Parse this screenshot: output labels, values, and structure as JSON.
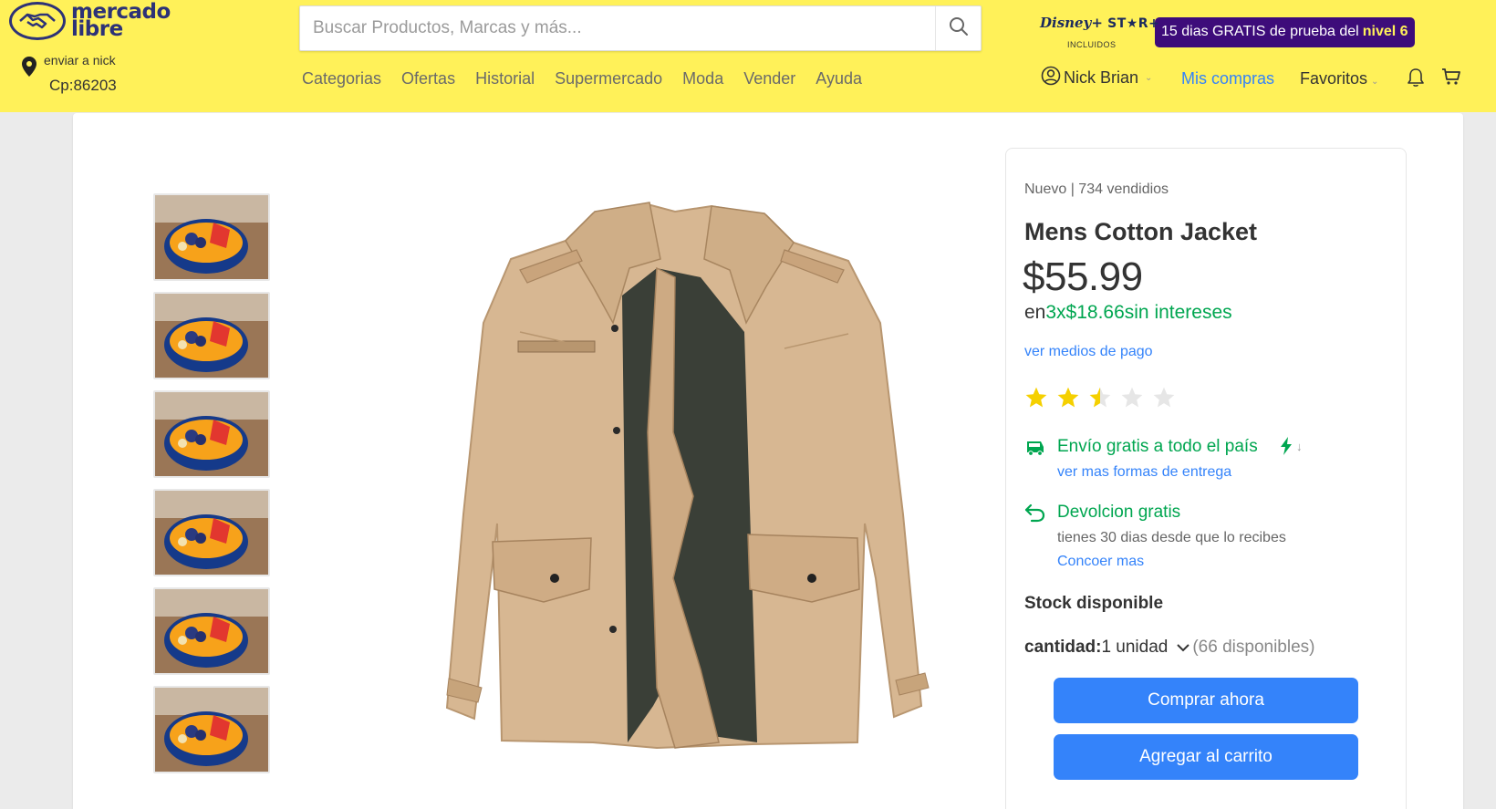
{
  "brand": {
    "line1": "mercado",
    "line2": "libre"
  },
  "location": {
    "line1": "enviar a nick",
    "line2": "Cp:86203"
  },
  "search": {
    "placeholder": "Buscar Productos, Marcas y más..."
  },
  "nav": [
    "Categorias",
    "Ofertas",
    "Historial",
    "Supermercado",
    "Moda",
    "Vender",
    "Ayuda"
  ],
  "promo": {
    "disney_logo": "Disney+",
    "star_logo": "ST★R+",
    "included": "INCLUIDOS",
    "pill_text": "15 dias GRATIS de prueba del",
    "pill_level": "nivel 6"
  },
  "user": {
    "name": "Nick Brian",
    "purchases": "Mis compras",
    "favorites": "Favoritos"
  },
  "product": {
    "condition": "Nuevo | 734 vendidios",
    "title": "Mens Cotton Jacket",
    "price": "$55.99",
    "installments_prefix": "en",
    "installments_value": "3x$18.66sin intereses",
    "payments_link": "ver medios de pago",
    "rating": 2.5,
    "rating_max": 5
  },
  "shipping": {
    "title": "Envío gratis a todo el país",
    "link": "ver mas formas de entrega"
  },
  "returns": {
    "title": "Devolcion gratis",
    "subtitle": "tienes 30 dias desde que lo recibes",
    "link": "Concoer mas"
  },
  "stock": {
    "title": "Stock disponible",
    "qty_label": "cantidad:",
    "qty_value": "1 unidad",
    "available": "(66 disponibles)"
  },
  "actions": {
    "buy": "Comprar ahora",
    "add_cart": "Agregar al carrito"
  },
  "colors": {
    "header": "#fff159",
    "primary": "#3483fa",
    "green": "#00a650",
    "star": "#f5d000",
    "promo": "#3d0c7a"
  }
}
